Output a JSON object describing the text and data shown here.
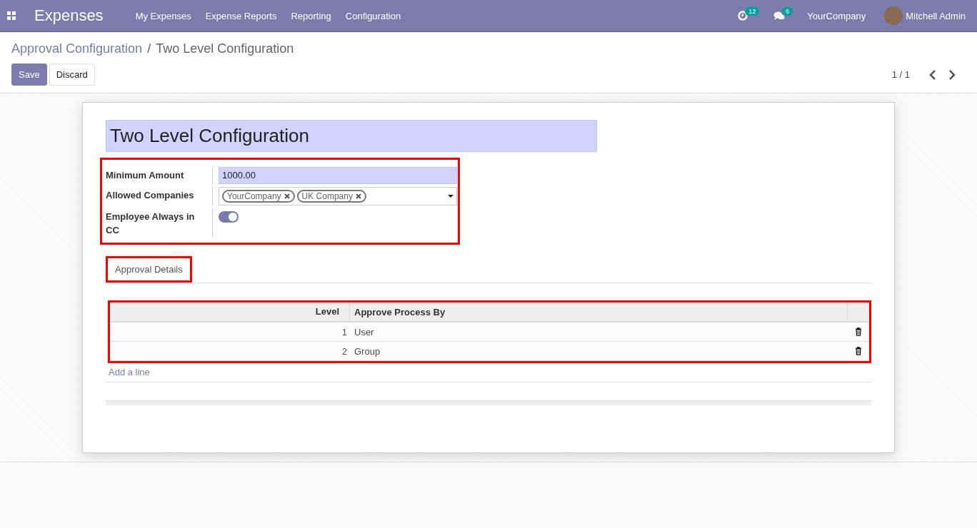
{
  "navbar": {
    "app_title": "Expenses",
    "menu": [
      "My Expenses",
      "Expense Reports",
      "Reporting",
      "Configuration"
    ],
    "activity_count": "12",
    "message_count": "6",
    "company": "YourCompany",
    "user": "Mitchell Admin"
  },
  "breadcrumb": {
    "parent": "Approval Configuration",
    "separator": "/",
    "current": "Two Level Configuration"
  },
  "buttons": {
    "save": "Save",
    "discard": "Discard"
  },
  "pager": "1 / 1",
  "form": {
    "name": "Two Level Configuration",
    "fields": [
      {
        "kind": "input",
        "label": "Minimum Amount",
        "value": "1000.00"
      },
      {
        "kind": "tags",
        "label": "Allowed Companies",
        "tags": [
          "YourCompany",
          "UK Company"
        ]
      },
      {
        "kind": "toggle",
        "label": "Employee Always in CC",
        "on": true
      }
    ],
    "tabs": [
      {
        "label": "Approval Details",
        "selected": true
      }
    ],
    "table": {
      "columns": [
        "Level",
        "Approve Process By"
      ],
      "rows": [
        {
          "level": "1",
          "approve_process_by": "User"
        },
        {
          "level": "2",
          "approve_process_by": "Group"
        }
      ],
      "add_line": "Add a line"
    }
  }
}
